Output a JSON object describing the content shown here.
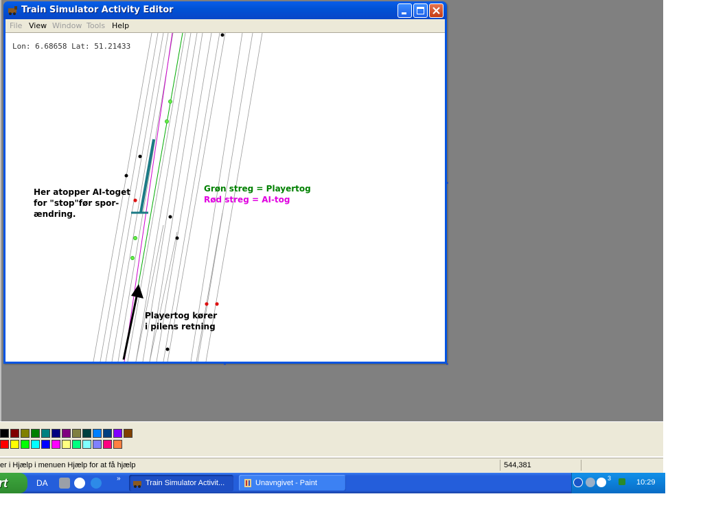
{
  "window": {
    "title": "Train Simulator Activity Editor",
    "menu": [
      {
        "label": "File",
        "enabled": false
      },
      {
        "label": "View",
        "enabled": true
      },
      {
        "label": "Window",
        "enabled": false
      },
      {
        "label": "Tools",
        "enabled": false
      },
      {
        "label": "Help",
        "enabled": true
      }
    ]
  },
  "map": {
    "coordinates": "Lon: 6.68658 Lat: 51.21433",
    "annotation_stop": "Her atopper AI-toget\nfor \"stop\"før spor-\nændring.",
    "legend_green": "Grøn streg = Playertog",
    "legend_red": "Rød streg = AI-tog",
    "annotation_direction": "Playertog kører\ni pilens retning",
    "colors": {
      "player_line": "#00aa00",
      "ai_line": "#cc00cc",
      "legend_green": "#008000",
      "legend_red": "#e000e0",
      "marker_teal": "#1b7a85"
    }
  },
  "paint": {
    "status_hint": "er i Hjælp i menuen Hjælp for at få hjælp",
    "status_coords": "544,381",
    "palette_row1": [
      "#000000",
      "#800000",
      "#808000",
      "#008000",
      "#008080",
      "#000080",
      "#800080",
      "#808040",
      "#004040",
      "#0080ff",
      "#004080",
      "#8000ff",
      "#804000"
    ],
    "palette_row2": [
      "#ff0000",
      "#ffff00",
      "#00ff00",
      "#00ffff",
      "#0000ff",
      "#ff00ff",
      "#ffff80",
      "#00ff80",
      "#80ffff",
      "#8080ff",
      "#ff0080",
      "#ff8040"
    ]
  },
  "taskbar": {
    "start_label": "rt",
    "language": "DA",
    "tasks": [
      {
        "label": "Train Simulator Activit...",
        "active": true
      },
      {
        "label": "Unavngivet - Paint",
        "active": false
      }
    ],
    "tray_badge": "3",
    "clock": "10:29"
  }
}
